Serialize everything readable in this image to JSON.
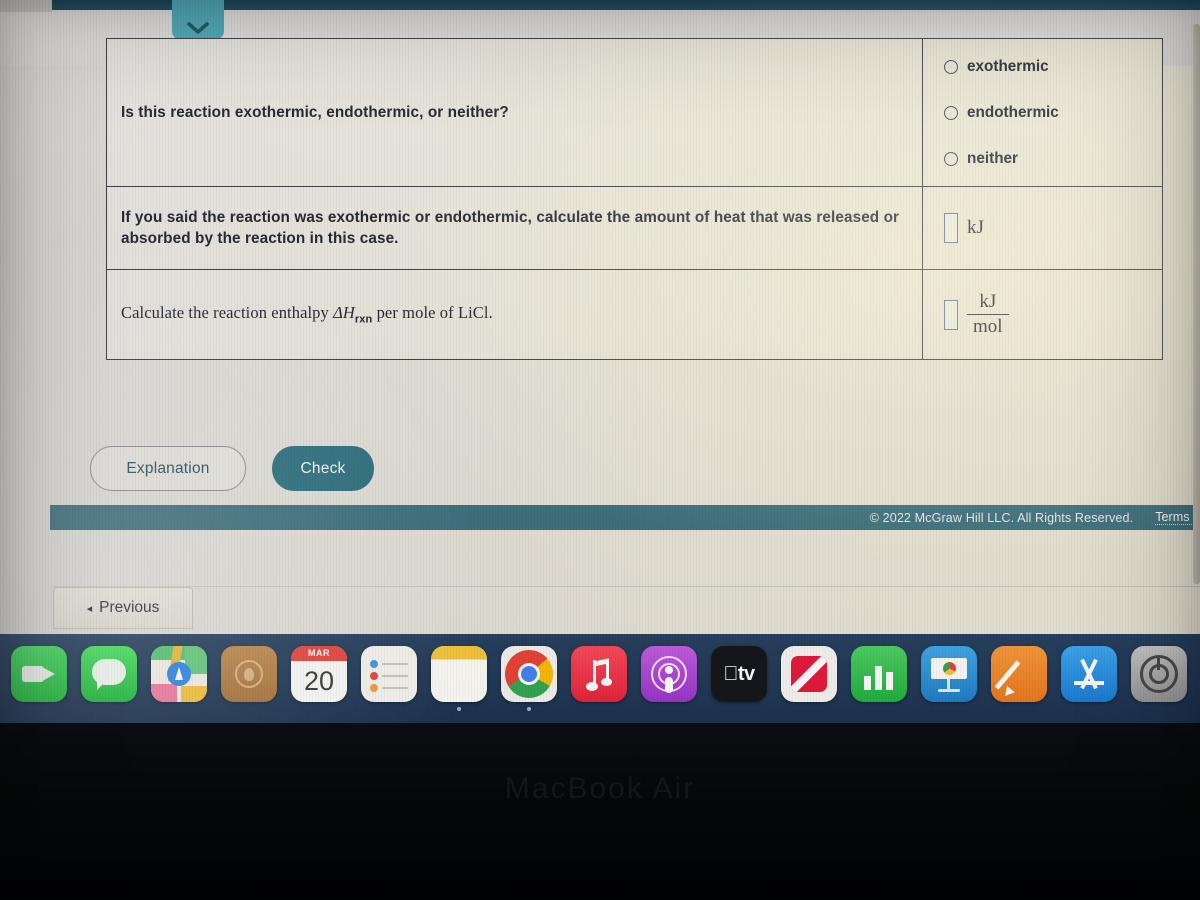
{
  "browser": {
    "tab_icon": "chevron-down-icon"
  },
  "question_table": {
    "rows": [
      {
        "prompt": "Is this reaction exothermic, endothermic, or neither?",
        "answer_type": "radio",
        "options": [
          "exothermic",
          "endothermic",
          "neither"
        ],
        "selected": ""
      },
      {
        "prompt": "If you said the reaction was exothermic or endothermic, calculate the amount of heat that was released or absorbed by the reaction in this case.",
        "answer_type": "input",
        "value": "",
        "unit": "kJ"
      },
      {
        "prompt_prefix": "Calculate the reaction enthalpy ",
        "prompt_symbol": "ΔH",
        "prompt_subscript": "rxn",
        "prompt_suffix": " per mole of LiCl.",
        "answer_type": "input-fraction",
        "value": "",
        "unit_numerator": "kJ",
        "unit_denominator": "mol"
      }
    ]
  },
  "actions": {
    "explanation_label": "Explanation",
    "check_label": "Check"
  },
  "footer": {
    "copyright": "© 2022 McGraw Hill LLC. All Rights Reserved.",
    "terms_label": "Terms o"
  },
  "navigation": {
    "previous_arrow": "◂",
    "previous_label": "Previous"
  },
  "dock": {
    "items": [
      {
        "name": "facetime",
        "label": "FaceTime",
        "running": false
      },
      {
        "name": "messages",
        "label": "Messages",
        "running": false
      },
      {
        "name": "maps",
        "label": "Maps",
        "running": false
      },
      {
        "name": "photos",
        "label": "Photos",
        "running": false
      },
      {
        "name": "calendar",
        "label": "Calendar",
        "running": false,
        "month": "MAR",
        "day": "20"
      },
      {
        "name": "reminders",
        "label": "Reminders",
        "running": false
      },
      {
        "name": "notes",
        "label": "Notes",
        "running": true
      },
      {
        "name": "chrome",
        "label": "Google Chrome",
        "running": true
      },
      {
        "name": "music",
        "label": "Music",
        "running": false
      },
      {
        "name": "podcasts",
        "label": "Podcasts",
        "running": false
      },
      {
        "name": "appletv",
        "label": "Apple TV",
        "running": false
      },
      {
        "name": "news",
        "label": "News",
        "running": false
      },
      {
        "name": "numbers",
        "label": "Numbers",
        "running": false
      },
      {
        "name": "keynote",
        "label": "Keynote",
        "running": false
      },
      {
        "name": "pages",
        "label": "Pages",
        "running": false
      },
      {
        "name": "appstore",
        "label": "App Store",
        "running": false
      },
      {
        "name": "sysprefs",
        "label": "System Preferences",
        "running": false
      }
    ]
  },
  "device": {
    "brand": "MacBook Air"
  },
  "colors": {
    "accent_teal": "#2b6e7c",
    "tab_teal": "#4aa8b8",
    "footer_teal": "#3d6f7c",
    "dock_navy": "#223a58",
    "border_dark": "#3a3a40"
  }
}
